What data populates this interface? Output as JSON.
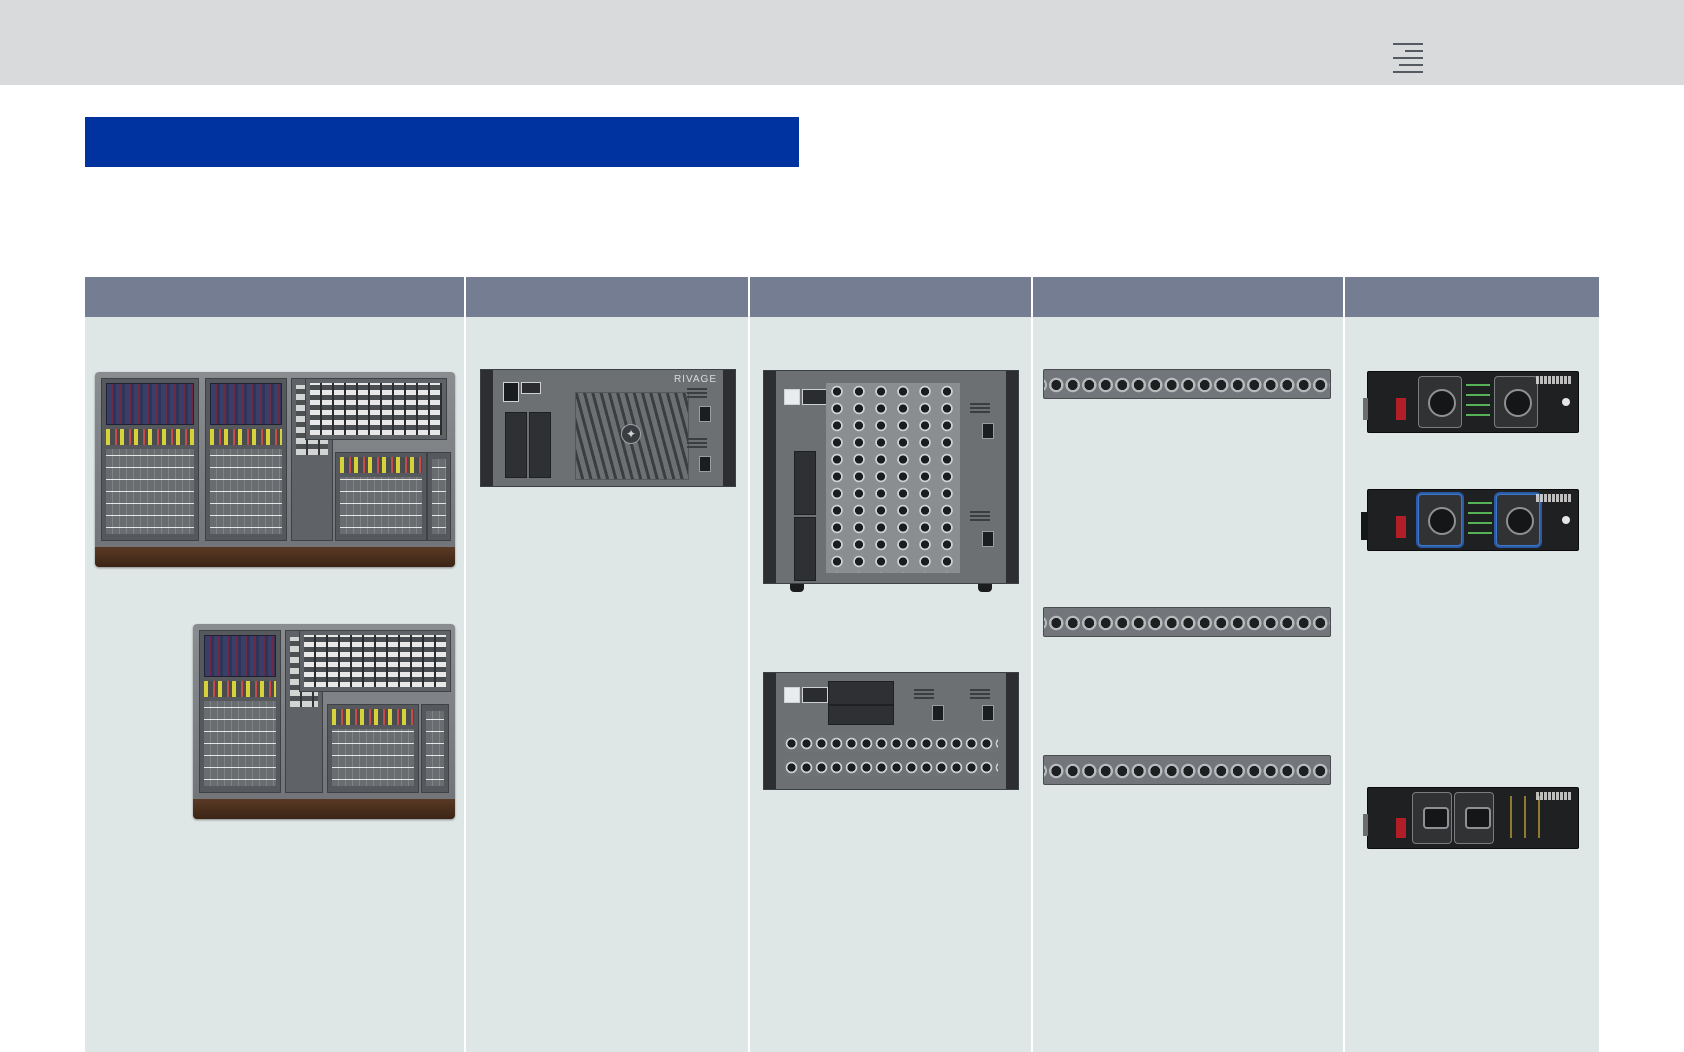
{
  "header": {
    "menu_icon": "hamburger-menu-icon"
  },
  "table": {
    "columns": [
      {
        "key": "consoles"
      },
      {
        "key": "engines"
      },
      {
        "key": "io-racks"
      },
      {
        "key": "stage-boxes"
      },
      {
        "key": "network-cards"
      }
    ]
  },
  "colors": {
    "top_bar": "#d9dadc",
    "banner": "#0032a0",
    "column_header": "#747d92",
    "column_body": "#dfe6e6"
  },
  "branding": {
    "engine_front_label": "RIVAGE"
  }
}
